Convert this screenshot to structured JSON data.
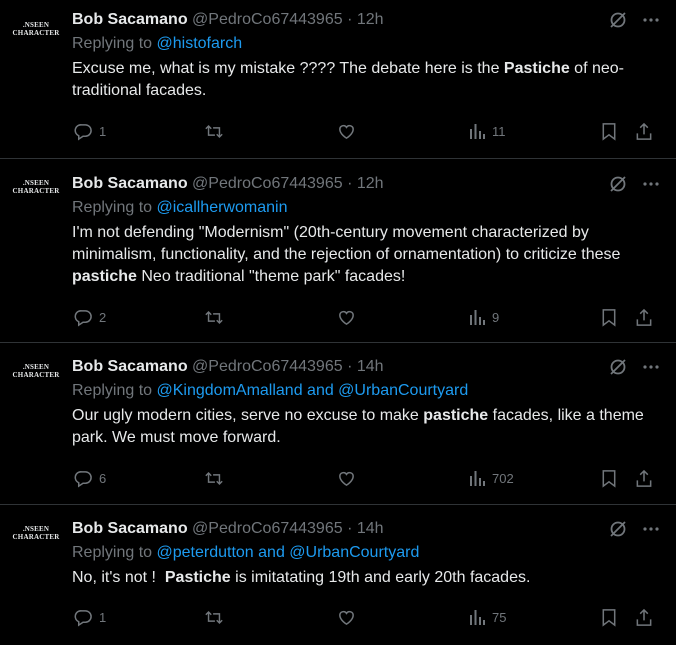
{
  "tweets": [
    {
      "avatar_text": [
        ".NSEEN",
        "CHARACTER"
      ],
      "name": "Bob Sacamano",
      "handle": "@PedroCo67443965",
      "dot": "·",
      "time": "12h",
      "replying_prefix": "Replying to",
      "replying_to": "@histofarch",
      "body_parts": [
        "Excuse me, what is my mistake ???? The debate here is the ",
        "Pastiche",
        " of neo-traditional facades."
      ],
      "replies": "1",
      "reposts": "",
      "likes": "",
      "views": "11"
    },
    {
      "avatar_text": [
        ".NSEEN",
        "CHARACTER"
      ],
      "name": "Bob Sacamano",
      "handle": "@PedroCo67443965",
      "dot": "·",
      "time": "12h",
      "replying_prefix": "Replying to",
      "replying_to": "@icallherwomanin",
      "body_parts": [
        "I'm not defending \"Modernism\" (20th-century movement characterized by minimalism, functionality, and the rejection of ornamentation) to criticize these ",
        "pastiche",
        " Neo traditional \"theme park\" facades!"
      ],
      "replies": "2",
      "reposts": "",
      "likes": "",
      "views": "9"
    },
    {
      "avatar_text": [
        ".NSEEN",
        "CHARACTER"
      ],
      "name": "Bob Sacamano",
      "handle": "@PedroCo67443965",
      "dot": "·",
      "time": "14h",
      "replying_prefix": "Replying to",
      "replying_to": "@KingdomAmalland and @UrbanCourtyard",
      "body_parts": [
        "Our ugly modern cities, serve no excuse to make ",
        "pastiche",
        " facades, like a theme park. We must move forward."
      ],
      "replies": "6",
      "reposts": "",
      "likes": "",
      "views": "702"
    },
    {
      "avatar_text": [
        ".NSEEN",
        "CHARACTER"
      ],
      "name": "Bob Sacamano",
      "handle": "@PedroCo67443965",
      "dot": "·",
      "time": "14h",
      "replying_prefix": "Replying to",
      "replying_to": "@peterdutton and @UrbanCourtyard",
      "body_parts": [
        "No, it's not !  ",
        "Pastiche",
        " is imitatating 19th and early 20th facades."
      ],
      "replies": "1",
      "reposts": "",
      "likes": "",
      "views": "75"
    }
  ],
  "icons": {
    "grok": "grok-icon",
    "more": "more-icon",
    "reply": "reply-icon",
    "repost": "repost-icon",
    "like": "like-icon",
    "views": "views-icon",
    "bookmark": "bookmark-icon",
    "share": "share-icon"
  },
  "colors": {
    "background": "#000000",
    "text": "#e7e9ea",
    "muted": "#71767b",
    "link": "#1d9bf0",
    "border": "#2f3336"
  }
}
